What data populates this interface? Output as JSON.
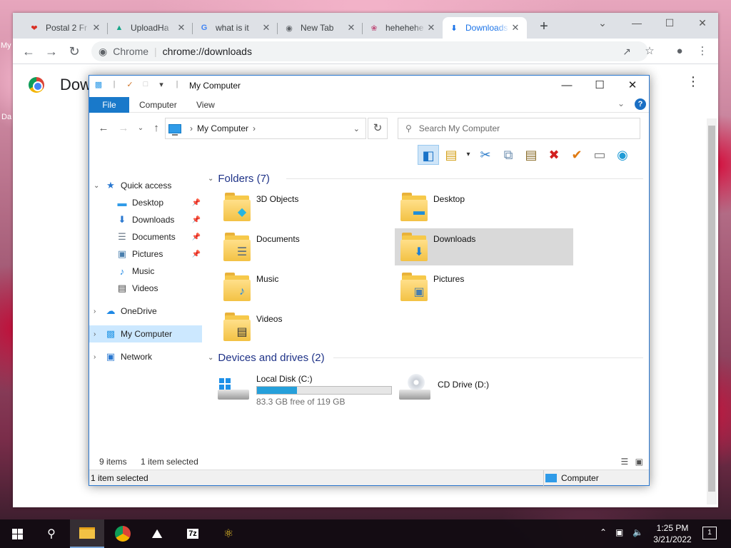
{
  "desktop": {
    "label_top": "My",
    "label_mid": "Da"
  },
  "chrome": {
    "tabs": [
      {
        "title": "Postal 2 Fr",
        "fav_text": "❤",
        "fav_color": "#d93025",
        "active": false
      },
      {
        "title": "UploadHa",
        "fav_text": "▲",
        "fav_color": "#17a589",
        "active": false
      },
      {
        "title": "what is it",
        "fav_text": "G",
        "fav_color": "#4285f4",
        "active": false
      },
      {
        "title": "New Tab",
        "fav_text": "◉",
        "fav_color": "#5f6368",
        "active": false
      },
      {
        "title": "hehehehe",
        "fav_text": "❀",
        "fav_color": "#c0507c",
        "active": false
      },
      {
        "title": "Downloads",
        "fav_text": "⬇",
        "fav_color": "#1a73e8",
        "active": true
      }
    ],
    "new_tab": "+",
    "omnibox": {
      "site": "Chrome",
      "url": "chrome://downloads"
    },
    "page_title": "Downloads",
    "page_title_visible": "Dow"
  },
  "explorer": {
    "title": "My Computer",
    "ribbon": {
      "file": "File",
      "tabs": [
        "Computer",
        "View"
      ]
    },
    "address": {
      "crumb": "My Computer"
    },
    "search_placeholder": "Search My Computer",
    "nav": {
      "quick_access": "Quick access",
      "quick_items": [
        {
          "label": "Desktop",
          "icon": "desktop-icon",
          "glyph": "▬",
          "color": "#2f9be8",
          "pinned": true
        },
        {
          "label": "Downloads",
          "icon": "downloads-icon",
          "glyph": "⬇",
          "color": "#2a78d0",
          "pinned": true
        },
        {
          "label": "Documents",
          "icon": "documents-icon",
          "glyph": "☰",
          "color": "#6c7a89",
          "pinned": true
        },
        {
          "label": "Pictures",
          "icon": "pictures-icon",
          "glyph": "▣",
          "color": "#4a7fae",
          "pinned": true
        },
        {
          "label": "Music",
          "icon": "music-icon",
          "glyph": "♪",
          "color": "#1e88e5",
          "pinned": false
        },
        {
          "label": "Videos",
          "icon": "videos-icon",
          "glyph": "▤",
          "color": "#444444",
          "pinned": false
        }
      ],
      "onedrive": "OneDrive",
      "my_computer": "My Computer",
      "network": "Network"
    },
    "folders_header": "Folders (7)",
    "folders": [
      {
        "name": "3D Objects",
        "icon": "3d-objects-icon",
        "glyph": "◆",
        "color": "#28b5e0"
      },
      {
        "name": "Desktop",
        "icon": "desktop-icon",
        "glyph": "▬",
        "color": "#1f8ed8"
      },
      {
        "name": "Documents",
        "icon": "documents-icon",
        "glyph": "☰",
        "color": "#5a6b7b"
      },
      {
        "name": "Downloads",
        "icon": "downloads-icon",
        "glyph": "⬇",
        "color": "#1e7fd6",
        "selected": true
      },
      {
        "name": "Music",
        "icon": "music-icon",
        "glyph": "♪",
        "color": "#1e88e5"
      },
      {
        "name": "Pictures",
        "icon": "pictures-icon",
        "glyph": "▣",
        "color": "#4a7fae"
      },
      {
        "name": "Videos",
        "icon": "videos-icon",
        "glyph": "▤",
        "color": "#333333"
      }
    ],
    "drives_header": "Devices and drives (2)",
    "drives": [
      {
        "name": "Local Disk (C:)",
        "free": "83.3 GB free of 119 GB",
        "used_fraction": 0.3
      },
      {
        "name": "CD Drive (D:)"
      }
    ],
    "status": {
      "items": "9 items",
      "selected": "1 item selected"
    },
    "statusbar": {
      "left": "1 item selected",
      "right": "Computer"
    }
  },
  "taskbar": {
    "time": "1:25 PM",
    "date": "3/21/2022",
    "notifications": "1",
    "apps": [
      {
        "name": "file-explorer",
        "active": true
      },
      {
        "name": "chrome",
        "active": false
      },
      {
        "name": "photos",
        "active": false
      },
      {
        "name": "7zip",
        "label": "7z",
        "active": false
      },
      {
        "name": "game",
        "active": false
      }
    ]
  }
}
